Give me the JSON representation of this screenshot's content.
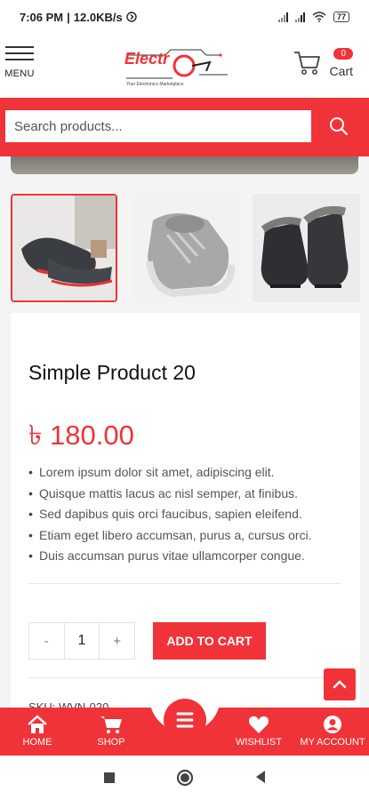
{
  "status_bar": {
    "time": "7:06 PM",
    "speed": "12.0KB/s",
    "battery": "77"
  },
  "header": {
    "menu_label": "MENU",
    "logo_text": "Electr",
    "logo_tagline": "Your Electronics Marketplace",
    "cart_count": "0",
    "cart_label": "Cart"
  },
  "search": {
    "placeholder": "Search products..."
  },
  "product": {
    "title": "Simple Product 20",
    "price": "৳ 180.00",
    "bullets": [
      "Lorem ipsum dolor sit amet, adipiscing elit.",
      "Quisque mattis lacus ac nisl semper, at finibus.",
      "Sed dapibus quis orci faucibus, sapien eleifend.",
      "Etiam eget libero accumsan, purus a, cursus orci.",
      "Duis accumsan purus vitae ullamcorper congue."
    ],
    "quantity": "1",
    "minus": "-",
    "plus": "+",
    "add_to_cart": "ADD TO CART",
    "sku": "SKU: WVN-020",
    "thumbnails": [
      "sneaker-dark-icon",
      "sneaker-grey-icon",
      "boot-dark-icon"
    ]
  },
  "bottom_nav": [
    {
      "label": "HOME",
      "icon": "home-icon"
    },
    {
      "label": "SHOP",
      "icon": "shop-cart-icon"
    },
    {
      "label": "WISHLIST",
      "icon": "heart-icon"
    },
    {
      "label": "MY ACCOUNT",
      "icon": "user-icon"
    }
  ],
  "colors": {
    "accent": "#ef3338",
    "background": "#f4f4f4"
  }
}
